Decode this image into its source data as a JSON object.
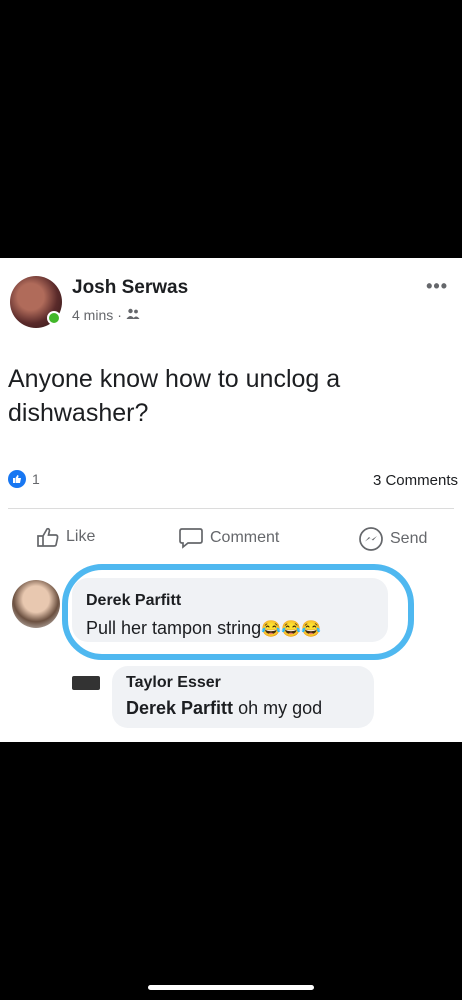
{
  "post": {
    "author": "Josh Serwas",
    "time": "4 mins",
    "audience_icon": "friends-icon",
    "text": "Anyone know how to unclog a dishwasher?",
    "reaction_count": "1",
    "comments_count": "3 Comments"
  },
  "actions": {
    "like": "Like",
    "comment": "Comment",
    "send": "Send"
  },
  "comments": [
    {
      "author": "Derek Parfitt",
      "text": "Pull her tampon string",
      "emoji": [
        "😂",
        "😂",
        "😂"
      ]
    }
  ],
  "reply": {
    "author": "Taylor Esser",
    "mention": "Derek Parfitt",
    "text": "oh my god"
  },
  "colors": {
    "highlight": "#4fb8f0",
    "like_blue": "#1877f2",
    "messenger_blue": "#0084ff"
  }
}
